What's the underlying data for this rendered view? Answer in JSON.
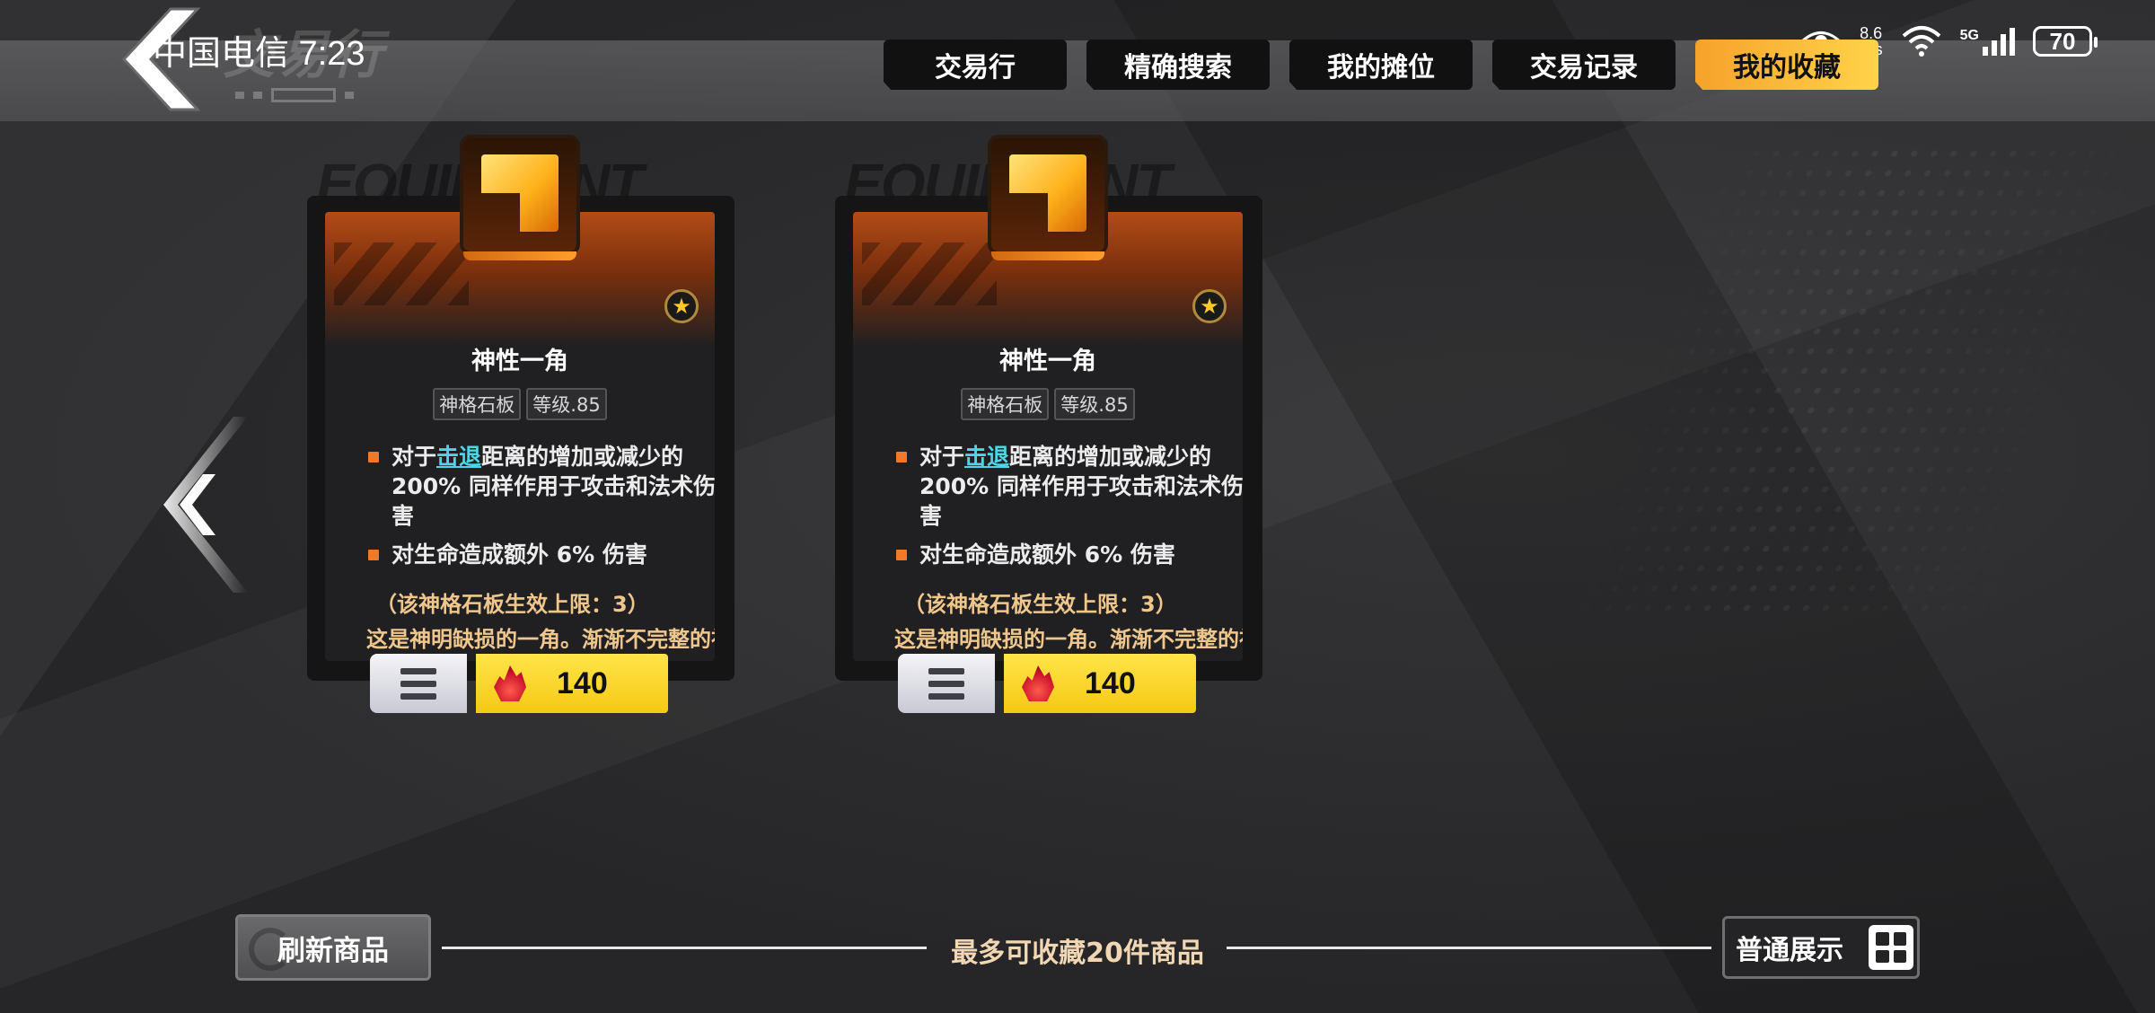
{
  "status_bar": {
    "carrier_time": "中国电信 7:23",
    "net_speed_value": "8.6",
    "net_speed_unit": "K/s",
    "network_type": "5G",
    "battery": "70"
  },
  "header": {
    "page_title": "交易行"
  },
  "tabs": [
    {
      "label": "交易行",
      "active": false
    },
    {
      "label": "精确搜索",
      "active": false
    },
    {
      "label": "我的摊位",
      "active": false
    },
    {
      "label": "交易记录",
      "active": false
    },
    {
      "label": "我的收藏",
      "active": true
    }
  ],
  "cards": [
    {
      "watermark": "EQUIPMENT",
      "name": "神性一角",
      "tags": [
        "神格石板",
        "等级.85"
      ],
      "bullet1_pre": "对于",
      "bullet1_keyword": "击退",
      "bullet1_post": "距离的增加或减少的200% 同样作用于攻击和法术伤害",
      "bullet2": "对生命造成额外 6% 伤害",
      "limit": "（该神格石板生效上限：3）",
      "lore": "这是神明缺损的一角。渐渐不完整的神明似乎在暗示万界的终局。",
      "price": "140"
    },
    {
      "watermark": "EQUIPMENT",
      "name": "神性一角",
      "tags": [
        "神格石板",
        "等级.85"
      ],
      "bullet1_pre": "对于",
      "bullet1_keyword": "击退",
      "bullet1_post": "距离的增加或减少的200% 同样作用于攻击和法术伤害",
      "bullet2": "对生命造成额外 6% 伤害",
      "limit": "（该神格石板生效上限：3）",
      "lore": "这是神明缺损的一角。渐渐不完整的神明似乎在暗示万界的终局。",
      "price": "140"
    }
  ],
  "footer": {
    "refresh_label": "刷新商品",
    "caption": "最多可收藏20件商品",
    "display_mode_label": "普通展示"
  },
  "colors": {
    "accent_tab": "#ffd34a",
    "price_bg": "#f5c912",
    "keyword": "#4fd5e6",
    "lore_text": "#efc78d"
  }
}
